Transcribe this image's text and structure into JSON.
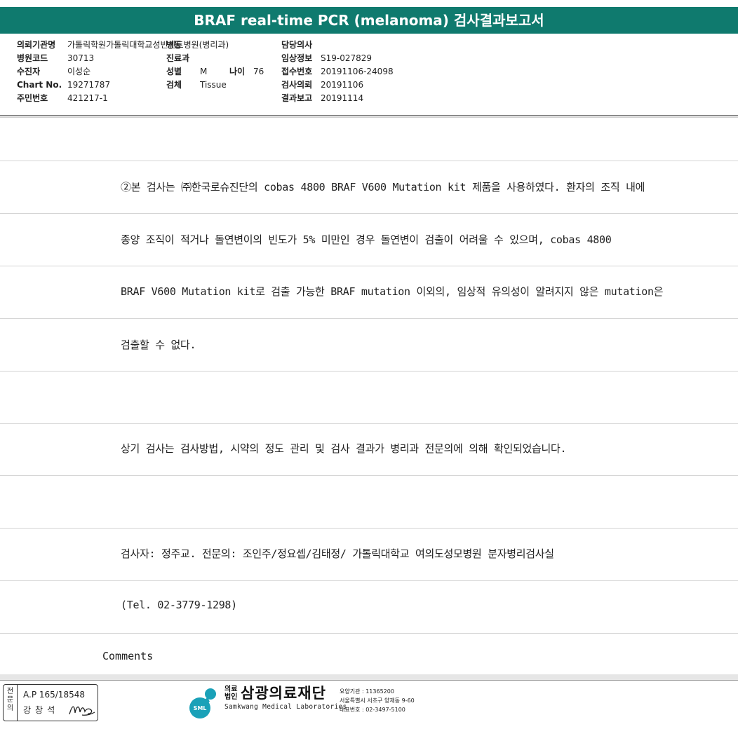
{
  "header": {
    "title": "BRAF real-time PCR (melanoma) 검사결과보고서"
  },
  "patient": {
    "col1": [
      {
        "label": "의뢰기관명",
        "value": "가톨릭학원가톨릭대학교성빈센트병원(병리과)"
      },
      {
        "label": "병원코드",
        "value": "30713"
      },
      {
        "label": "수진자",
        "value": "이성순"
      },
      {
        "label": "Chart No.",
        "value": "19271787"
      },
      {
        "label": "주민번호",
        "value": "421217-1"
      }
    ],
    "col2": {
      "ward_label": "병동",
      "ward_value": "",
      "dept_label": "진료과",
      "dept_value": "",
      "sex_label": "성별",
      "sex_value": "M",
      "age_label": "나이",
      "age_value": "76",
      "specimen_label": "검체",
      "specimen_value": "Tissue"
    },
    "col3": [
      {
        "label": "담당의사",
        "value": ""
      },
      {
        "label": "임상정보",
        "value": "S19-027829"
      },
      {
        "label": "접수번호",
        "value": "20191106-24098"
      },
      {
        "label": "검사의뢰",
        "value": "20191106"
      },
      {
        "label": "결과보고",
        "value": "20191114"
      }
    ]
  },
  "body": {
    "lines": [
      "②본 검사는 ㈜한국로슈진단의 cobas 4800 BRAF V600 Mutation kit 제품을 사용하였다. 환자의 조직 내에",
      "종양 조직이 적거나 돌연변이의 빈도가 5% 미만인 경우 돌연변이 검출이 어려울 수 있으며, cobas 4800",
      "BRAF V600 Mutation kit로 검출 가능한 BRAF mutation 이외의, 임상적 유의성이 알려지지 않은 mutation은",
      "검출할 수 없다.",
      "상기 검사는 검사방법, 시약의 정도 관리 및 검사 결과가 병리과 전문의에 의해 확인되었습니다.",
      "검사자: 정주교.  전문의: 조인주/정요셉/김태정/ 가톨릭대학교 여의도성모병원 분자병리검사실",
      "(Tel. 02-3779-1298)"
    ],
    "comments_label": "Comments"
  },
  "footer": {
    "stamp_side": "전문의",
    "stamp_license": "A.P 165/18548",
    "stamp_name": "강창석",
    "logo_corp": "의료\n법인",
    "logo_name": "삼광의료재단",
    "logo_mark_text": "SML",
    "logo_english": "Samkwang Medical Laboratories",
    "info": [
      "요양기관 : 11365200",
      "서울특별시 서초구 양재동 9-60",
      "대표번호 : 02-3497-5100"
    ]
  },
  "colors": {
    "header_bg": "#0f7a6e",
    "rule": "#d4d4d4"
  }
}
